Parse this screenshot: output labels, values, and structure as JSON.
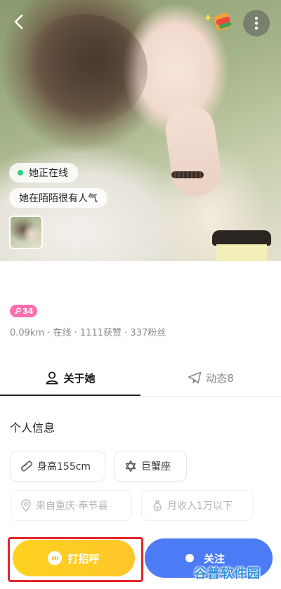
{
  "status": {
    "online": "她正在线",
    "popular": "她在陌陌很有人气"
  },
  "profile": {
    "badge_value": "34",
    "stats": "0.09km · 在线 · 1111获赞 · 337粉丝"
  },
  "tabs": [
    {
      "label": "关于她",
      "active": true,
      "icon": "user-outline-icon"
    },
    {
      "label": "动态8",
      "active": false,
      "icon": "paper-plane-icon"
    }
  ],
  "personal_info": {
    "title": "个人信息",
    "chips": [
      {
        "label": "身高155cm",
        "icon": "ruler-icon"
      },
      {
        "label": "巨蟹座",
        "icon": "star-of-david-icon"
      },
      {
        "label": "来自重庆·奉节县",
        "icon": "location-pin-icon"
      },
      {
        "label": "月收入1万以下",
        "icon": "money-bag-icon"
      }
    ]
  },
  "actions": {
    "greet": "打招呼",
    "greet_icon_text": "Hi",
    "follow": "关注"
  },
  "watermark": "谷普软件园",
  "colors": {
    "greet": "#ffc91f",
    "follow": "#4c7bf6",
    "highlight": "#e3262b",
    "badge": "#ff6fae",
    "online_dot": "#2ed27b"
  }
}
